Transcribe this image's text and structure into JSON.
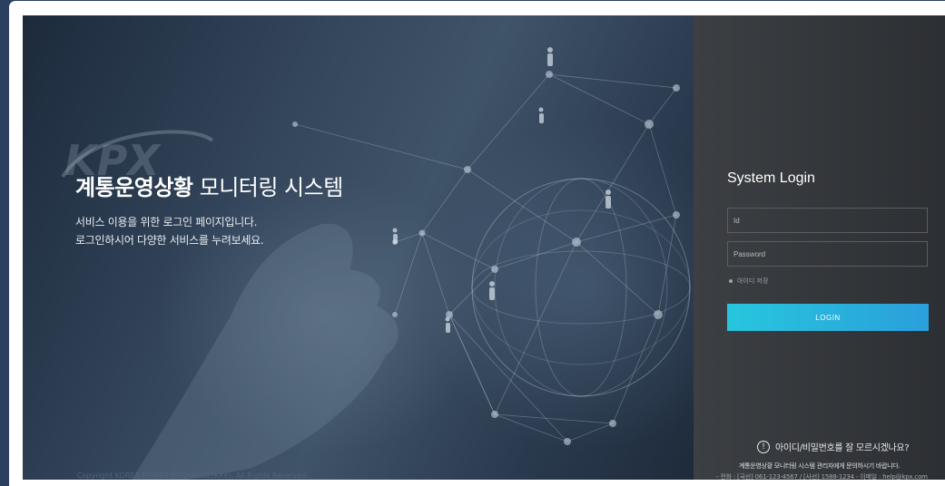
{
  "hero": {
    "logo_text": "KPX",
    "title_bold": "계통운영상황",
    "title_rest": " 모니터링 시스템",
    "desc_line1": "서비스 이용을 위한 로그인 페이지입니다.",
    "desc_line2": "로그인하시어 다양한 서비스를 누려보세요.",
    "copyright": "Copyright KOREA POWER EXCHANGE(KPX). All Rights Reserved."
  },
  "login": {
    "title": "System Login",
    "id_placeholder": "Id",
    "id_value": "",
    "password_placeholder": "Password",
    "password_value": "",
    "remember_label": "아이디 저장",
    "remember_checked": false,
    "login_label": "LOGIN",
    "help_icon": "!",
    "help_text": "아이디/비밀번호를 잘 모르시겠나요?",
    "help_desc": "계통운영상황 모니터링 시스템 관리자에게 문의하시기 바랍니다.",
    "contact": "- 전화 : [국선] 061-123-4567 / [사선] 1588-1234    - 이메일 : help@kpx.com"
  },
  "colors": {
    "accent_start": "#27c6dd",
    "accent_end": "#2a9fdc",
    "panel_bg": "#33363a",
    "outer_bg": "#2b3f5e"
  },
  "icons": {
    "help": "exclamation-circle-icon",
    "remember": "bullet-icon"
  }
}
